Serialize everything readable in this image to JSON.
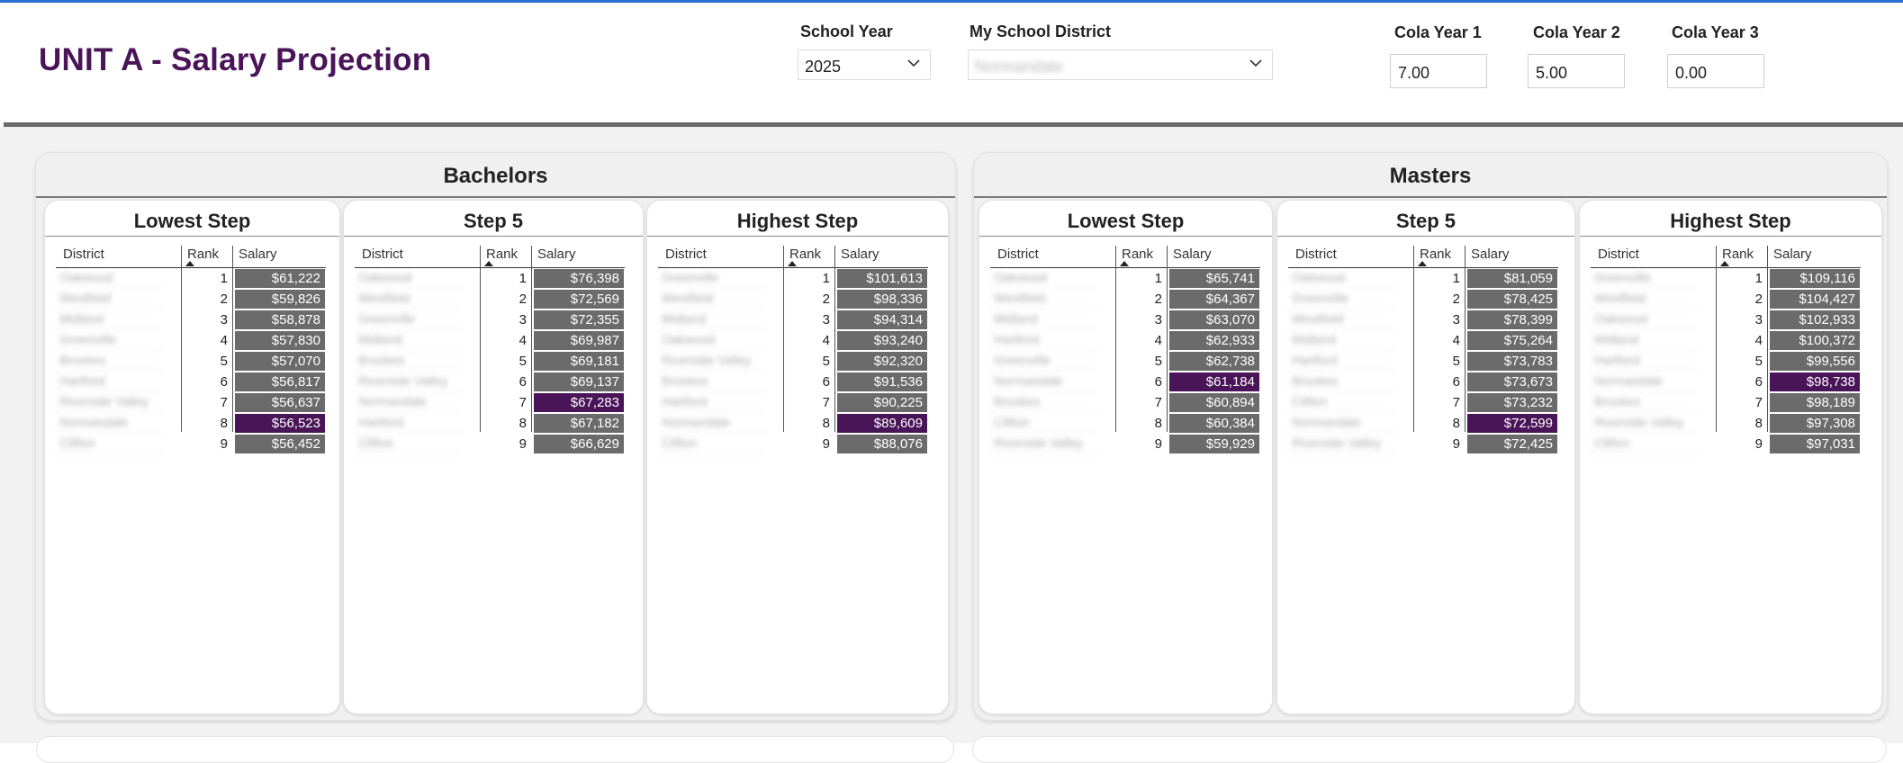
{
  "header": {
    "title": "UNIT A - Salary Projection",
    "school_year": {
      "label": "School Year",
      "value": "2025"
    },
    "district": {
      "label": "My School District",
      "value": "Normandale"
    },
    "cola1": {
      "label": "Cola Year 1",
      "value": "7.00"
    },
    "cola2": {
      "label": "Cola Year 2",
      "value": "5.00"
    },
    "cola3": {
      "label": "Cola Year 3",
      "value": "0.00"
    }
  },
  "colors": {
    "accent": "#4a1458",
    "salary_cell": "#6b6b6b",
    "top_rule": "#2b6fd6"
  },
  "columns": {
    "district": "District",
    "rank": "Rank",
    "salary": "Salary"
  },
  "groups": [
    {
      "title": "Bachelors",
      "tables": [
        {
          "title": "Lowest Step",
          "rows": [
            {
              "district": "Oakwood",
              "rank": "1",
              "salary": "$61,222",
              "hl": false
            },
            {
              "district": "Westfield",
              "rank": "2",
              "salary": "$59,826",
              "hl": false
            },
            {
              "district": "Midland",
              "rank": "3",
              "salary": "$58,878",
              "hl": false
            },
            {
              "district": "Greenville",
              "rank": "4",
              "salary": "$57,830",
              "hl": false
            },
            {
              "district": "Brookes",
              "rank": "5",
              "salary": "$57,070",
              "hl": false
            },
            {
              "district": "Hartford",
              "rank": "6",
              "salary": "$56,817",
              "hl": false
            },
            {
              "district": "Riverside Valley",
              "rank": "7",
              "salary": "$56,637",
              "hl": false
            },
            {
              "district": "Normandale",
              "rank": "8",
              "salary": "$56,523",
              "hl": true
            },
            {
              "district": "Clifton",
              "rank": "9",
              "salary": "$56,452",
              "hl": false
            }
          ]
        },
        {
          "title": "Step 5",
          "rows": [
            {
              "district": "Oakwood",
              "rank": "1",
              "salary": "$76,398",
              "hl": false
            },
            {
              "district": "Westfield",
              "rank": "2",
              "salary": "$72,569",
              "hl": false
            },
            {
              "district": "Greenville",
              "rank": "3",
              "salary": "$72,355",
              "hl": false
            },
            {
              "district": "Midland",
              "rank": "4",
              "salary": "$69,987",
              "hl": false
            },
            {
              "district": "Brookes",
              "rank": "5",
              "salary": "$69,181",
              "hl": false
            },
            {
              "district": "Riverside Valley",
              "rank": "6",
              "salary": "$69,137",
              "hl": false
            },
            {
              "district": "Normandale",
              "rank": "7",
              "salary": "$67,283",
              "hl": true
            },
            {
              "district": "Hartford",
              "rank": "8",
              "salary": "$67,182",
              "hl": false
            },
            {
              "district": "Clifton",
              "rank": "9",
              "salary": "$66,629",
              "hl": false
            }
          ]
        },
        {
          "title": "Highest Step",
          "rows": [
            {
              "district": "Greenville",
              "rank": "1",
              "salary": "$101,613",
              "hl": false
            },
            {
              "district": "Westfield",
              "rank": "2",
              "salary": "$98,336",
              "hl": false
            },
            {
              "district": "Midland",
              "rank": "3",
              "salary": "$94,314",
              "hl": false
            },
            {
              "district": "Oakwood",
              "rank": "4",
              "salary": "$93,240",
              "hl": false
            },
            {
              "district": "Riverside Valley",
              "rank": "5",
              "salary": "$92,320",
              "hl": false
            },
            {
              "district": "Brookes",
              "rank": "6",
              "salary": "$91,536",
              "hl": false
            },
            {
              "district": "Hartford",
              "rank": "7",
              "salary": "$90,225",
              "hl": false
            },
            {
              "district": "Normandale",
              "rank": "8",
              "salary": "$89,609",
              "hl": true
            },
            {
              "district": "Clifton",
              "rank": "9",
              "salary": "$88,076",
              "hl": false
            }
          ]
        }
      ]
    },
    {
      "title": "Masters",
      "tables": [
        {
          "title": "Lowest Step",
          "rows": [
            {
              "district": "Oakwood",
              "rank": "1",
              "salary": "$65,741",
              "hl": false
            },
            {
              "district": "Westfield",
              "rank": "2",
              "salary": "$64,367",
              "hl": false
            },
            {
              "district": "Midland",
              "rank": "3",
              "salary": "$63,070",
              "hl": false
            },
            {
              "district": "Hartford",
              "rank": "4",
              "salary": "$62,933",
              "hl": false
            },
            {
              "district": "Greenville",
              "rank": "5",
              "salary": "$62,738",
              "hl": false
            },
            {
              "district": "Normandale",
              "rank": "6",
              "salary": "$61,184",
              "hl": true
            },
            {
              "district": "Brookes",
              "rank": "7",
              "salary": "$60,894",
              "hl": false
            },
            {
              "district": "Clifton",
              "rank": "8",
              "salary": "$60,384",
              "hl": false
            },
            {
              "district": "Riverside Valley",
              "rank": "9",
              "salary": "$59,929",
              "hl": false
            }
          ]
        },
        {
          "title": "Step 5",
          "rows": [
            {
              "district": "Oakwood",
              "rank": "1",
              "salary": "$81,059",
              "hl": false
            },
            {
              "district": "Greenville",
              "rank": "2",
              "salary": "$78,425",
              "hl": false
            },
            {
              "district": "Westfield",
              "rank": "3",
              "salary": "$78,399",
              "hl": false
            },
            {
              "district": "Midland",
              "rank": "4",
              "salary": "$75,264",
              "hl": false
            },
            {
              "district": "Hartford",
              "rank": "5",
              "salary": "$73,783",
              "hl": false
            },
            {
              "district": "Brookes",
              "rank": "6",
              "salary": "$73,673",
              "hl": false
            },
            {
              "district": "Clifton",
              "rank": "7",
              "salary": "$73,232",
              "hl": false
            },
            {
              "district": "Normandale",
              "rank": "8",
              "salary": "$72,599",
              "hl": true
            },
            {
              "district": "Riverside Valley",
              "rank": "9",
              "salary": "$72,425",
              "hl": false
            }
          ]
        },
        {
          "title": "Highest Step",
          "rows": [
            {
              "district": "Greenville",
              "rank": "1",
              "salary": "$109,116",
              "hl": false
            },
            {
              "district": "Westfield",
              "rank": "2",
              "salary": "$104,427",
              "hl": false
            },
            {
              "district": "Oakwood",
              "rank": "3",
              "salary": "$102,933",
              "hl": false
            },
            {
              "district": "Midland",
              "rank": "4",
              "salary": "$100,372",
              "hl": false
            },
            {
              "district": "Hartford",
              "rank": "5",
              "salary": "$99,556",
              "hl": false
            },
            {
              "district": "Normandale",
              "rank": "6",
              "salary": "$98,738",
              "hl": true
            },
            {
              "district": "Brookes",
              "rank": "7",
              "salary": "$98,189",
              "hl": false
            },
            {
              "district": "Riverside Valley",
              "rank": "8",
              "salary": "$97,308",
              "hl": false
            },
            {
              "district": "Clifton",
              "rank": "9",
              "salary": "$97,031",
              "hl": false
            }
          ]
        }
      ]
    }
  ]
}
